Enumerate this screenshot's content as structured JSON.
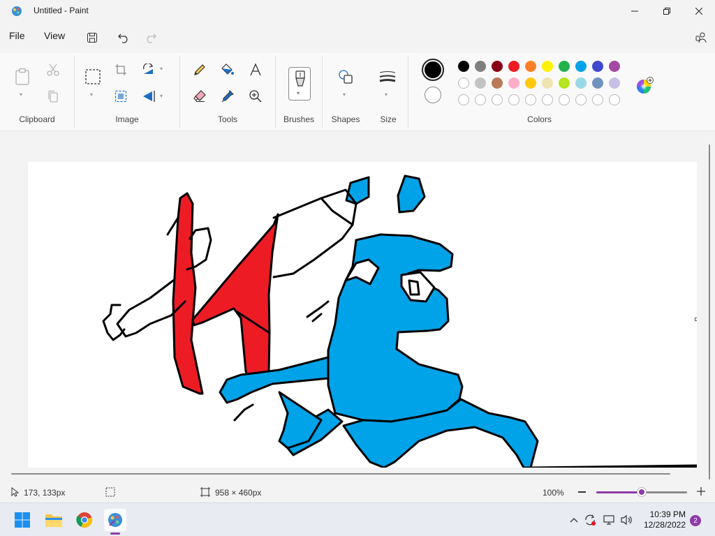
{
  "window": {
    "title": "Untitled - Paint",
    "minimize_label": "—",
    "maximize_label": "☐",
    "close_label": "✕"
  },
  "menu": {
    "file": "File",
    "view": "View"
  },
  "ribbon": {
    "groups": {
      "clipboard": "Clipboard",
      "image": "Image",
      "tools": "Tools",
      "brushes": "Brushes",
      "shapes": "Shapes",
      "size": "Size",
      "colors": "Colors"
    },
    "palette_row1": [
      "#000000",
      "#7f7f7f",
      "#880015",
      "#ed1c24",
      "#ff7f27",
      "#fff200",
      "#22b14c",
      "#00a2e8",
      "#3f48cc",
      "#a349a4"
    ],
    "palette_row2": [
      "#ffffff",
      "#c3c3c3",
      "#b97a57",
      "#ffaec9",
      "#ffc90e",
      "#efe4b0",
      "#b5e61d",
      "#99d9ea",
      "#7092be",
      "#c8bfe7"
    ],
    "primary_color": "#000000",
    "secondary_color": "#ffffff"
  },
  "status": {
    "cursor_position": "173, 133px",
    "canvas_size": "958 × 460px",
    "zoom": "100%",
    "zoom_level": 0.5
  },
  "taskbar": {
    "time": "10:39 PM",
    "date": "12/28/2022",
    "notifications": "2"
  }
}
